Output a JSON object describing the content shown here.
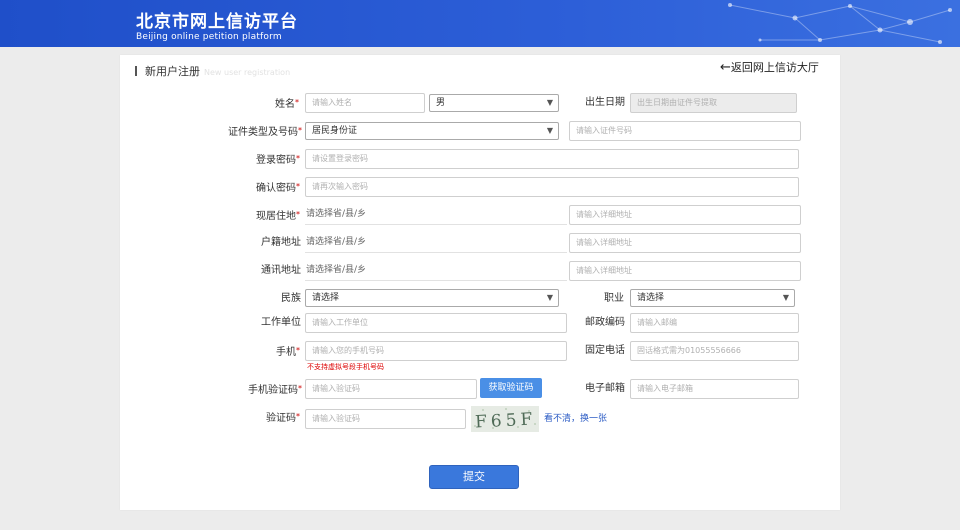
{
  "header": {
    "title_cn": "北京市网上信访平台",
    "title_en": "Beijing online petition platform"
  },
  "page": {
    "section_title": "新用户注册",
    "section_ghost": "New user registration",
    "back_label": "返回网上信访大厅"
  },
  "form": {
    "name": {
      "label": "姓名",
      "placeholder": "请输入姓名"
    },
    "gender": {
      "value": "男"
    },
    "birth": {
      "label": "出生日期",
      "placeholder": "出生日期由证件号提取"
    },
    "id_doc": {
      "label": "证件类型及号码",
      "type_value": "居民身份证",
      "number_placeholder": "请输入证件号码"
    },
    "password": {
      "label": "登录密码",
      "placeholder": "请设置登录密码"
    },
    "password_confirm": {
      "label": "确认密码",
      "placeholder": "请再次输入密码"
    },
    "residence": {
      "label": "现居住地",
      "region_placeholder": "请选择省/县/乡",
      "detail_placeholder": "请输入详细地址"
    },
    "household": {
      "label": "户籍地址",
      "region_placeholder": "请选择省/县/乡",
      "detail_placeholder": "请输入详细地址"
    },
    "mailing": {
      "label": "通讯地址",
      "region_placeholder": "请选择省/县/乡",
      "detail_placeholder": "请输入详细地址"
    },
    "ethnicity": {
      "label": "民族",
      "value": "请选择"
    },
    "occupation": {
      "label": "职业",
      "value": "请选择"
    },
    "workplace": {
      "label": "工作单位",
      "placeholder": "请输入工作单位"
    },
    "postcode": {
      "label": "邮政编码",
      "placeholder": "请输入邮编"
    },
    "mobile": {
      "label": "手机",
      "placeholder": "请输入您的手机号码",
      "hint": "不支持虚拟号段手机号码"
    },
    "landline": {
      "label": "固定电话",
      "placeholder": "固话格式需为01055556666"
    },
    "sms_code": {
      "label": "手机验证码",
      "placeholder": "请输入验证码",
      "button": "获取验证码"
    },
    "email": {
      "label": "电子邮箱",
      "placeholder": "请输入电子邮箱"
    },
    "captcha": {
      "label": "验证码",
      "placeholder": "请输入验证码",
      "image_text": "F65F",
      "refresh": "看不清，换一张"
    },
    "submit": "提交"
  }
}
